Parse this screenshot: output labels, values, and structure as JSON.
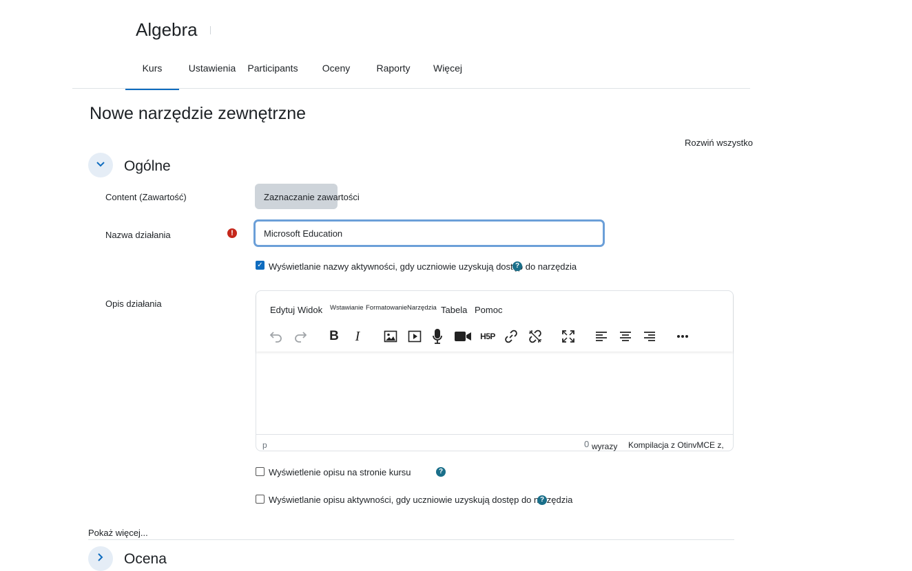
{
  "course": {
    "title": "Algebra"
  },
  "tabs": [
    {
      "label": "Kurs",
      "active": true
    },
    {
      "label": "Ustawienia"
    },
    {
      "label": "Participants"
    },
    {
      "label": "Oceny"
    },
    {
      "label": "Raporty"
    },
    {
      "label": "Więcej"
    }
  ],
  "page": {
    "heading": "Nowe narzędzie zewnętrzne",
    "expand_all": "Rozwiń wszystko"
  },
  "general": {
    "title": "Ogólne",
    "content_label": "Content (Zawartość)",
    "content_button": "Zaznaczanie zawartości",
    "name_label": "Nazwa działania",
    "name_value": "Microsoft Education",
    "show_name_label": "Wyświetlanie nazwy aktywności, gdy uczniowie uzyskują dostęp do narzędzia",
    "show_name_checked": true,
    "desc_label": "Opis działania",
    "show_desc_course_label": "Wyświetlenie opisu na stronie kursu",
    "show_desc_course_checked": false,
    "show_desc_activity_label": "Wyświetlanie opisu aktywności, gdy uczniowie uzyskują dostęp do narzędzia",
    "show_desc_activity_checked": false
  },
  "editor": {
    "menu": [
      "Edytuj",
      "Widok",
      "Wstawianie",
      "Formatowanie",
      "Narzędzia",
      "Tabela",
      "Pomoc"
    ],
    "tools": [
      "undo-icon",
      "redo-icon",
      "bold-icon",
      "italic-icon",
      "image-icon",
      "media-icon",
      "microphone-icon",
      "video-camera-icon",
      "h5p-icon",
      "link-icon",
      "unlink-icon",
      "fullscreen-icon",
      "align-left-icon",
      "align-center-icon",
      "align-right-icon",
      "more-icon"
    ],
    "h5p_text": "H5P",
    "status_path": "p",
    "word_count": "0",
    "word_label": "wyrazy",
    "brand": "Kompilacja z OtinvMCE z,"
  },
  "more": {
    "label": "Pokaż więcej..."
  },
  "grade": {
    "title": "Ocena"
  },
  "colors": {
    "accent": "#0f6cbf",
    "error": "#c5271b",
    "help": "#1a6f8a"
  }
}
